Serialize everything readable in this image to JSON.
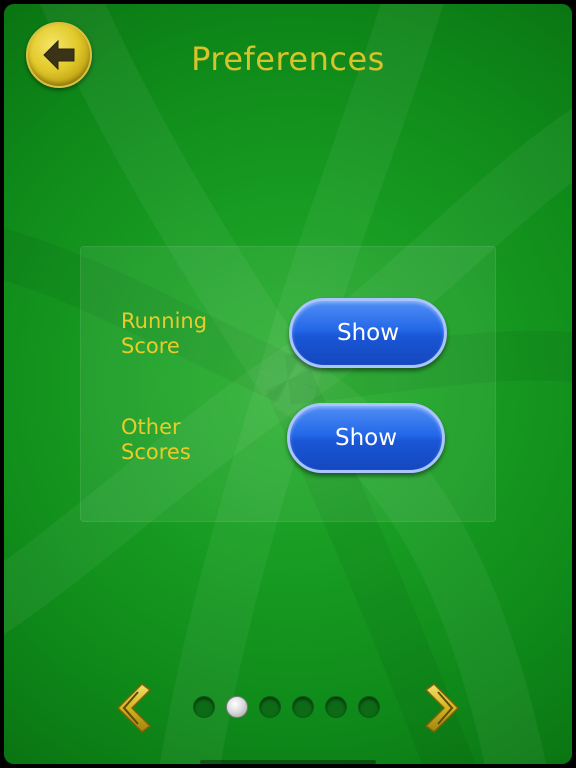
{
  "header": {
    "title": "Preferences",
    "back_icon": "arrow-left-icon"
  },
  "preferences": [
    {
      "label": "Running\nScore",
      "value": "Show"
    },
    {
      "label": "Other\nScores",
      "value": "Show"
    }
  ],
  "pagination": {
    "total_pages": 6,
    "current_page": 2,
    "prev_icon": "chevron-left-icon",
    "next_icon": "chevron-right-icon"
  },
  "colors": {
    "background": "#1aa024",
    "title": "#d9c32a",
    "label": "#e8cd2a",
    "button": "#2468e8",
    "back_button": "#e2c92a"
  }
}
